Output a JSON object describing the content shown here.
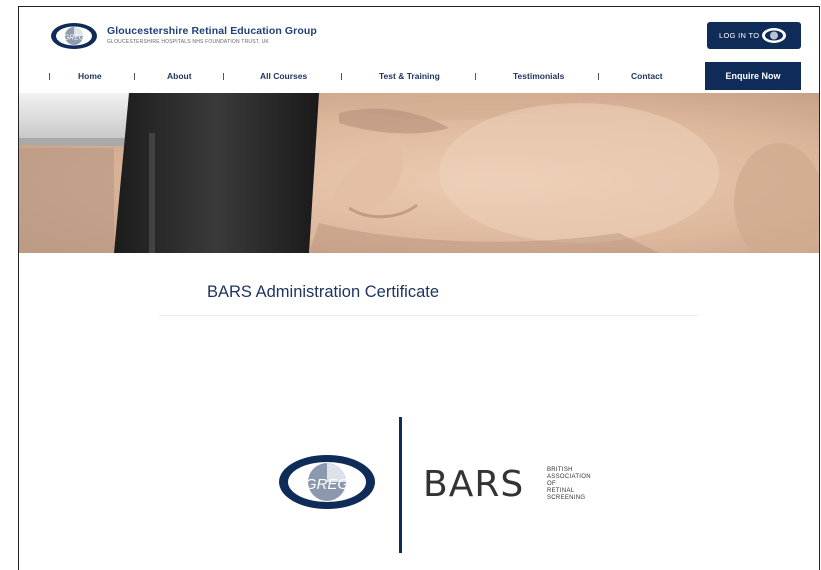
{
  "header": {
    "brand_title": "Gloucestershire Retinal Education Group",
    "brand_subtitle": "GLOUCESTERSHIRE HOSPITALS NHS FOUNDATION TRUST, UK",
    "logo_text": "GREG",
    "login_label": "LOG IN TO"
  },
  "nav": {
    "items": [
      {
        "label": "Home"
      },
      {
        "label": "About"
      },
      {
        "label": "All Courses"
      },
      {
        "label": "Test & Training"
      },
      {
        "label": "Testimonials"
      },
      {
        "label": "Contact"
      }
    ],
    "cta_label": "Enquire Now"
  },
  "main": {
    "title": "BARS Administration Certificate",
    "partner_logo_text": "GREG",
    "bars_letters": "BARS",
    "bars_lines": [
      "BRITISH",
      "ASSOCIATION",
      "OF",
      "RETINAL",
      "SCREENING"
    ]
  },
  "colors": {
    "brand_navy": "#0f2b57",
    "text_navy": "#1f3560"
  }
}
